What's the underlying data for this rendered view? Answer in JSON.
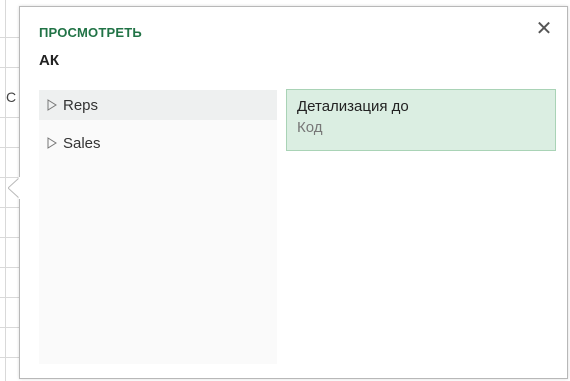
{
  "sheet": {
    "cell_text": "C"
  },
  "popup": {
    "title": "ПРОСМОТРЕТЬ",
    "subtitle": "АК",
    "close_glyph": "✕",
    "fields": [
      {
        "label": "Reps",
        "icon": "expand-triangle-icon"
      },
      {
        "label": "Sales",
        "icon": "expand-triangle-icon"
      }
    ],
    "drill": {
      "title": "Детализация до",
      "value": "Код"
    }
  },
  "colors": {
    "accent": "#217346",
    "drill_bg": "#dbeee2",
    "drill_border": "#a9d3b6",
    "selected_bg": "#eef0f0"
  }
}
